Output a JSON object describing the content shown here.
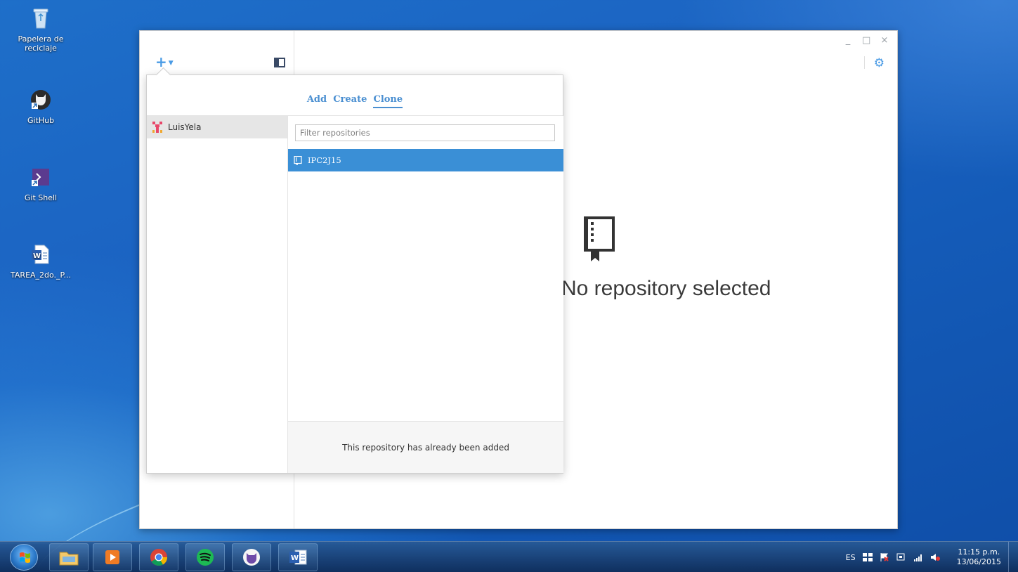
{
  "desktop": {
    "icons": [
      {
        "label": "Papelera de\nreciclaje"
      },
      {
        "label": "GitHub"
      },
      {
        "label": "Git Shell"
      },
      {
        "label": "TAREA_2do._P..."
      }
    ]
  },
  "window": {
    "controls": [
      "_",
      "□",
      "×"
    ]
  },
  "toolbar": {
    "add_icon": "plus-icon",
    "caret_icon": "chevron-down-icon"
  },
  "empty_state": {
    "text": "No repository selected"
  },
  "popover": {
    "tabs": [
      {
        "label": "Add"
      },
      {
        "label": "Create"
      },
      {
        "label": "Clone"
      }
    ],
    "active_tab": "Clone",
    "accounts": [
      {
        "name": "LuisYela"
      }
    ],
    "filter": {
      "placeholder": "Filter repositories",
      "value": ""
    },
    "repositories": [
      {
        "name": "IPC2J15"
      }
    ],
    "footer_message": "This repository has already been added"
  },
  "taskbar": {
    "language": "ES",
    "time": "11:15 p.m.",
    "date": "13/06/2015"
  },
  "colors": {
    "accent": "#4a8fd1",
    "selected_row": "#3a8fd6",
    "desktop_blue": "#1b63c2"
  }
}
